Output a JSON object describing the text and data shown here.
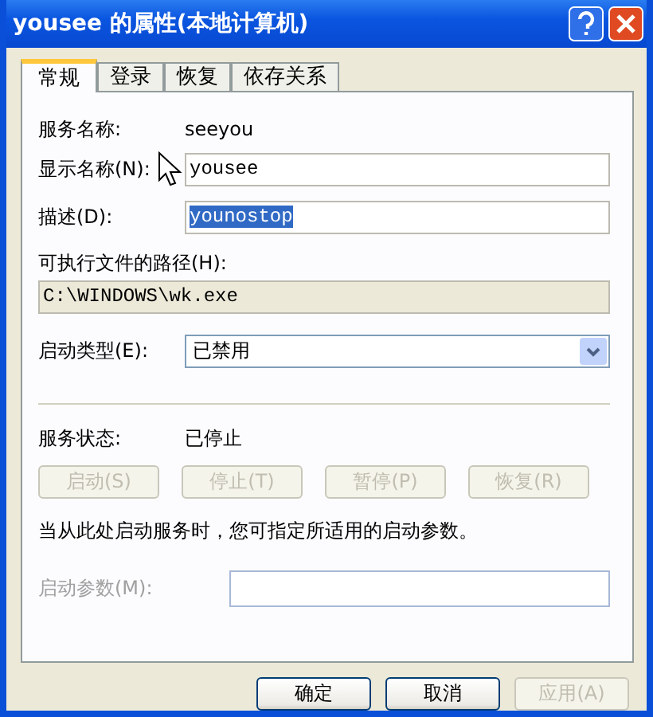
{
  "window": {
    "title": "yousee 的属性(本地计算机)"
  },
  "tabs": [
    {
      "label": "常规",
      "selected": true
    },
    {
      "label": "登录",
      "selected": false
    },
    {
      "label": "恢复",
      "selected": false
    },
    {
      "label": "依存关系",
      "selected": false
    }
  ],
  "service_name": {
    "label": "服务名称:",
    "value": "seeyou"
  },
  "display_name": {
    "label": "显示名称(N):",
    "value": "yousee"
  },
  "description": {
    "label": "描述(D):",
    "value": "younostop",
    "text_selected": true
  },
  "executable_path": {
    "label": "可执行文件的路径(H):",
    "value": "C:\\WINDOWS\\wk.exe"
  },
  "startup_type": {
    "label": "启动类型(E):",
    "value": "已禁用"
  },
  "service_status": {
    "label": "服务状态:",
    "value": "已停止"
  },
  "service_buttons": [
    {
      "label": "启动(S)",
      "disabled": true
    },
    {
      "label": "停止(T)",
      "disabled": true
    },
    {
      "label": "暂停(P)",
      "disabled": true
    },
    {
      "label": "恢复(R)",
      "disabled": true
    }
  ],
  "hint": "当从此处启动服务时，您可指定所适用的启动参数。",
  "start_parameters": {
    "label": "启动参数(M):",
    "disabled": true
  },
  "dialog_buttons": [
    {
      "label": "确定",
      "disabled": false
    },
    {
      "label": "取消",
      "disabled": false
    },
    {
      "label": "应用(A)",
      "disabled": true
    }
  ]
}
